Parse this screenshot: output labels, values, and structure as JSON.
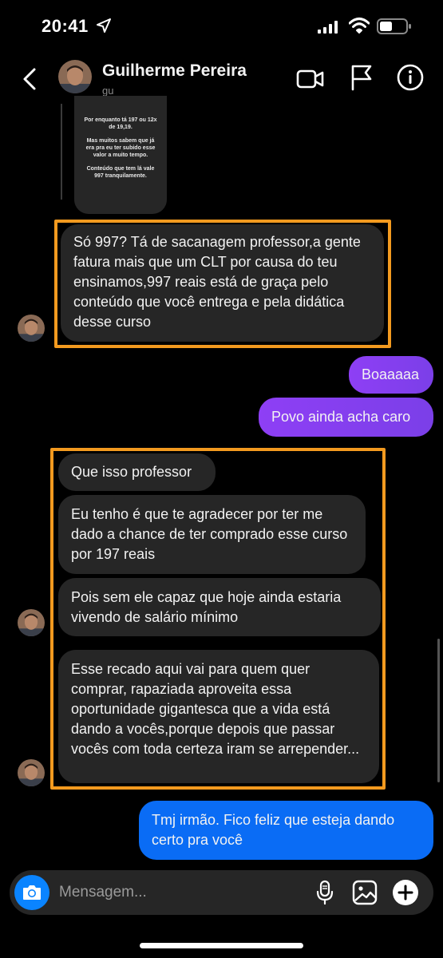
{
  "status_bar": {
    "time": "20:41"
  },
  "header": {
    "name": "Guilherme Pereira",
    "username": "gu"
  },
  "story": {
    "lines": [
      "Por enquanto tá 197 ou 12x de 19,19.",
      "Mas muitos sabem que já era pra eu ter subido esse valor a muito tempo.",
      "Conteúdo que tem lá vale 997 tranquilamente."
    ]
  },
  "messages": [
    {
      "id": "m1",
      "from": "them",
      "text": "Só 997? Tá de sacanagem professor,a gente fatura mais que um CLT por causa do teu ensinamos,997 reais está de graça pelo conteúdo que você entrega e pela didática desse curso"
    },
    {
      "id": "m2",
      "from": "me",
      "text": "Boaaaaa"
    },
    {
      "id": "m3",
      "from": "me",
      "text": "Povo ainda acha caro"
    },
    {
      "id": "m4",
      "from": "them",
      "text": "Que isso professor"
    },
    {
      "id": "m5",
      "from": "them",
      "text": "Eu tenho é que te agradecer por ter me dado a chance de ter comprado esse curso por 197 reais"
    },
    {
      "id": "m6",
      "from": "them",
      "text": "Pois sem ele capaz que hoje ainda estaria vivendo de salário mínimo"
    },
    {
      "id": "m7",
      "from": "them",
      "text": "Esse recado aqui vai para quem quer comprar, rapaziada aproveita essa oportunidade gigantesca que a vida está dando a vocês,porque depois que passar vocês com toda certeza iram se arrepender..."
    },
    {
      "id": "m8",
      "from": "me",
      "text": "Tmj irmão. Fico feliz que esteja dando certo pra você"
    }
  ],
  "composer": {
    "placeholder": "Mensagem..."
  },
  "colors": {
    "highlight": "#f39a1f",
    "sent_purple": "#7b3fe8",
    "sent_blue": "#0a6cf5",
    "received": "#262626"
  }
}
